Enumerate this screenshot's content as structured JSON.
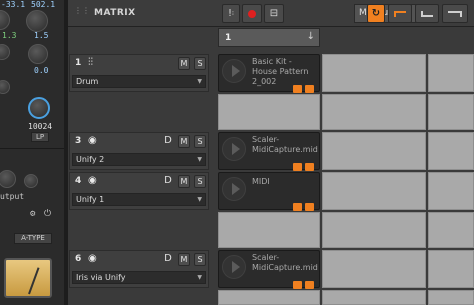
{
  "left_panel": {
    "values": [
      "-33.1",
      "502.1",
      "1.3",
      "1.5",
      "0.0"
    ],
    "readout": "10024",
    "lp_label": "LP",
    "output_label": "utput",
    "atype_label": "A-TYPE"
  },
  "header": {
    "title": "MATRIX",
    "mode_select": "Measure",
    "mode_arrow": "▾"
  },
  "scene": {
    "number": "1",
    "arrow": "↓"
  },
  "tracks": [
    {
      "number": "1",
      "icon": "drum-icon",
      "instrument": "Drum",
      "has_d": false
    },
    {
      "number": "3",
      "icon": "midi-icon",
      "instrument": "Unify 2",
      "has_d": true
    },
    {
      "number": "4",
      "icon": "midi-icon",
      "instrument": "Unify 1",
      "has_d": true
    },
    {
      "number": "6",
      "icon": "midi-icon",
      "instrument": "Iris via Unify",
      "has_d": true
    }
  ],
  "track_buttons": {
    "d": "D",
    "m": "M",
    "s": "S"
  },
  "clips": [
    {
      "name": "Basic Kit - House Pattern 2_002"
    },
    {
      "name": "Scaler-MidiCapture.mid"
    },
    {
      "name": "MIDI"
    },
    {
      "name": "Scaler-MidiCapture.mid"
    }
  ],
  "colors": {
    "accent_orange": "#f08020",
    "record_red": "#e02020",
    "cell_grey": "#a9a9a9"
  }
}
